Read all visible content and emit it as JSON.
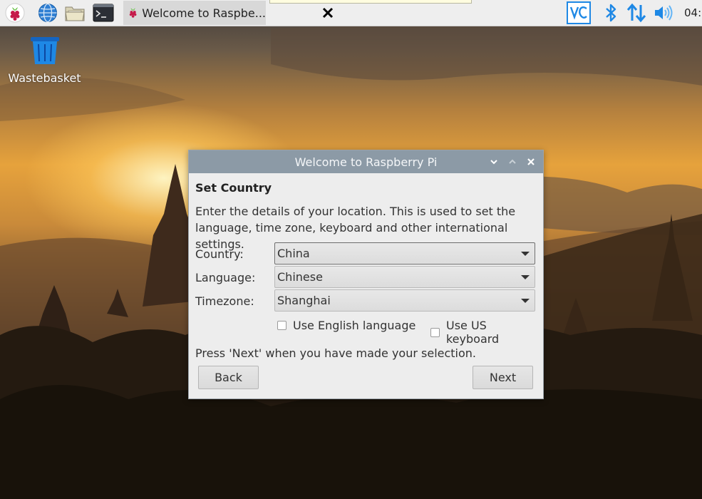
{
  "taskbar": {
    "launchers": [
      {
        "name": "raspberry-menu-icon"
      },
      {
        "name": "web-browser-icon"
      },
      {
        "name": "file-manager-icon"
      },
      {
        "name": "terminal-icon"
      }
    ],
    "task_title": "Welcome to Raspbe...",
    "tray": [
      "vnc-icon",
      "bluetooth-icon",
      "network-icon",
      "volume-icon"
    ],
    "clock": "04:"
  },
  "desktop": {
    "icons": [
      {
        "label": "Wastebasket"
      }
    ]
  },
  "dialog": {
    "title": "Welcome to Raspberry Pi",
    "heading": "Set Country",
    "description_line1": "Enter the details of your location. This is used to set the",
    "description_line2": "language, time zone, keyboard and other international settings.",
    "fields": {
      "country": {
        "label": "Country:",
        "value": "China"
      },
      "language": {
        "label": "Language:",
        "value": "Chinese"
      },
      "timezone": {
        "label": "Timezone:",
        "value": "Shanghai"
      }
    },
    "checkboxes": {
      "english": {
        "label": "Use English language",
        "checked": false
      },
      "us_keyboard": {
        "label": "Use US keyboard",
        "checked": false
      }
    },
    "hint": "Press 'Next' when you have made your selection.",
    "buttons": {
      "back": "Back",
      "next": "Next"
    }
  },
  "colors": {
    "taskbar_bg": "#eeeeee",
    "titlebar_bg": "#8c9aa6",
    "dialog_bg": "#ededed",
    "tray_blue": "#1e88e5",
    "raspberry_red": "#c51a4a",
    "leaf_green": "#6cc04a"
  }
}
